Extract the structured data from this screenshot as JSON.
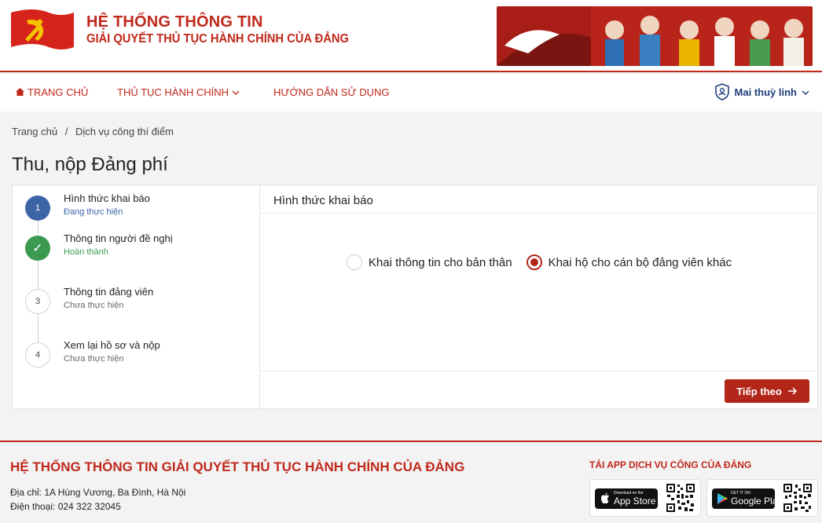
{
  "header": {
    "title_line1": "HỆ THỐNG THÔNG TIN",
    "title_line2": "GIẢI QUYẾT THỦ TỤC HÀNH CHÍNH CỦA ĐẢNG"
  },
  "nav": {
    "home": "TRANG CHỦ",
    "procedures": "THỦ TỤC HÀNH CHÍNH",
    "guide": "HƯỚNG DẪN SỬ DỤNG",
    "user_name": "Mai thuỳ linh"
  },
  "breadcrumb": {
    "home": "Trang chủ",
    "separator": "/",
    "current": "Dịch vụ công thí điểm"
  },
  "page_title": "Thu, nộp Đảng phí",
  "steps": [
    {
      "number": "1",
      "title": "Hình thức khai báo",
      "status": "Đang thực hiện",
      "state": "current"
    },
    {
      "number": "✓",
      "title": "Thông tin người đề nghị",
      "status": "Hoàn thành",
      "state": "done"
    },
    {
      "number": "3",
      "title": "Thông tin đảng viên",
      "status": "Chưa thực hiện",
      "state": "todo"
    },
    {
      "number": "4",
      "title": "Xem lại hồ sơ và nộp",
      "status": "Chưa thực hiện",
      "state": "todo"
    }
  ],
  "panel": {
    "heading": "Hình thức khai báo",
    "option_self": "Khai thông tin cho bản thân",
    "option_other": "Khai hộ cho cán bộ đảng viên khác",
    "selected": "option_other",
    "next_label": "Tiếp theo"
  },
  "footer": {
    "title": "HỆ THỐNG THÔNG TIN GIẢI QUYẾT THỦ TỤC HÀNH CHÍNH CỦA ĐẢNG",
    "address": "Địa chỉ: 1A Hùng Vương, Ba Đình, Hà Nội",
    "phone": "Điện thoại: 024 322 32045",
    "app_title": "TẢI APP DỊCH VỤ CÔNG CỦA ĐẢNG",
    "appstore_small": "Download on the",
    "appstore_big": "App Store",
    "googleplay_small": "GET IT ON",
    "googleplay_big": "Google Play"
  },
  "colors": {
    "brand_red": "#c0281c",
    "button_red": "#b3271b",
    "step_current": "#3c65a8",
    "step_done": "#3c9a50",
    "user_blue": "#1f3f7a"
  }
}
